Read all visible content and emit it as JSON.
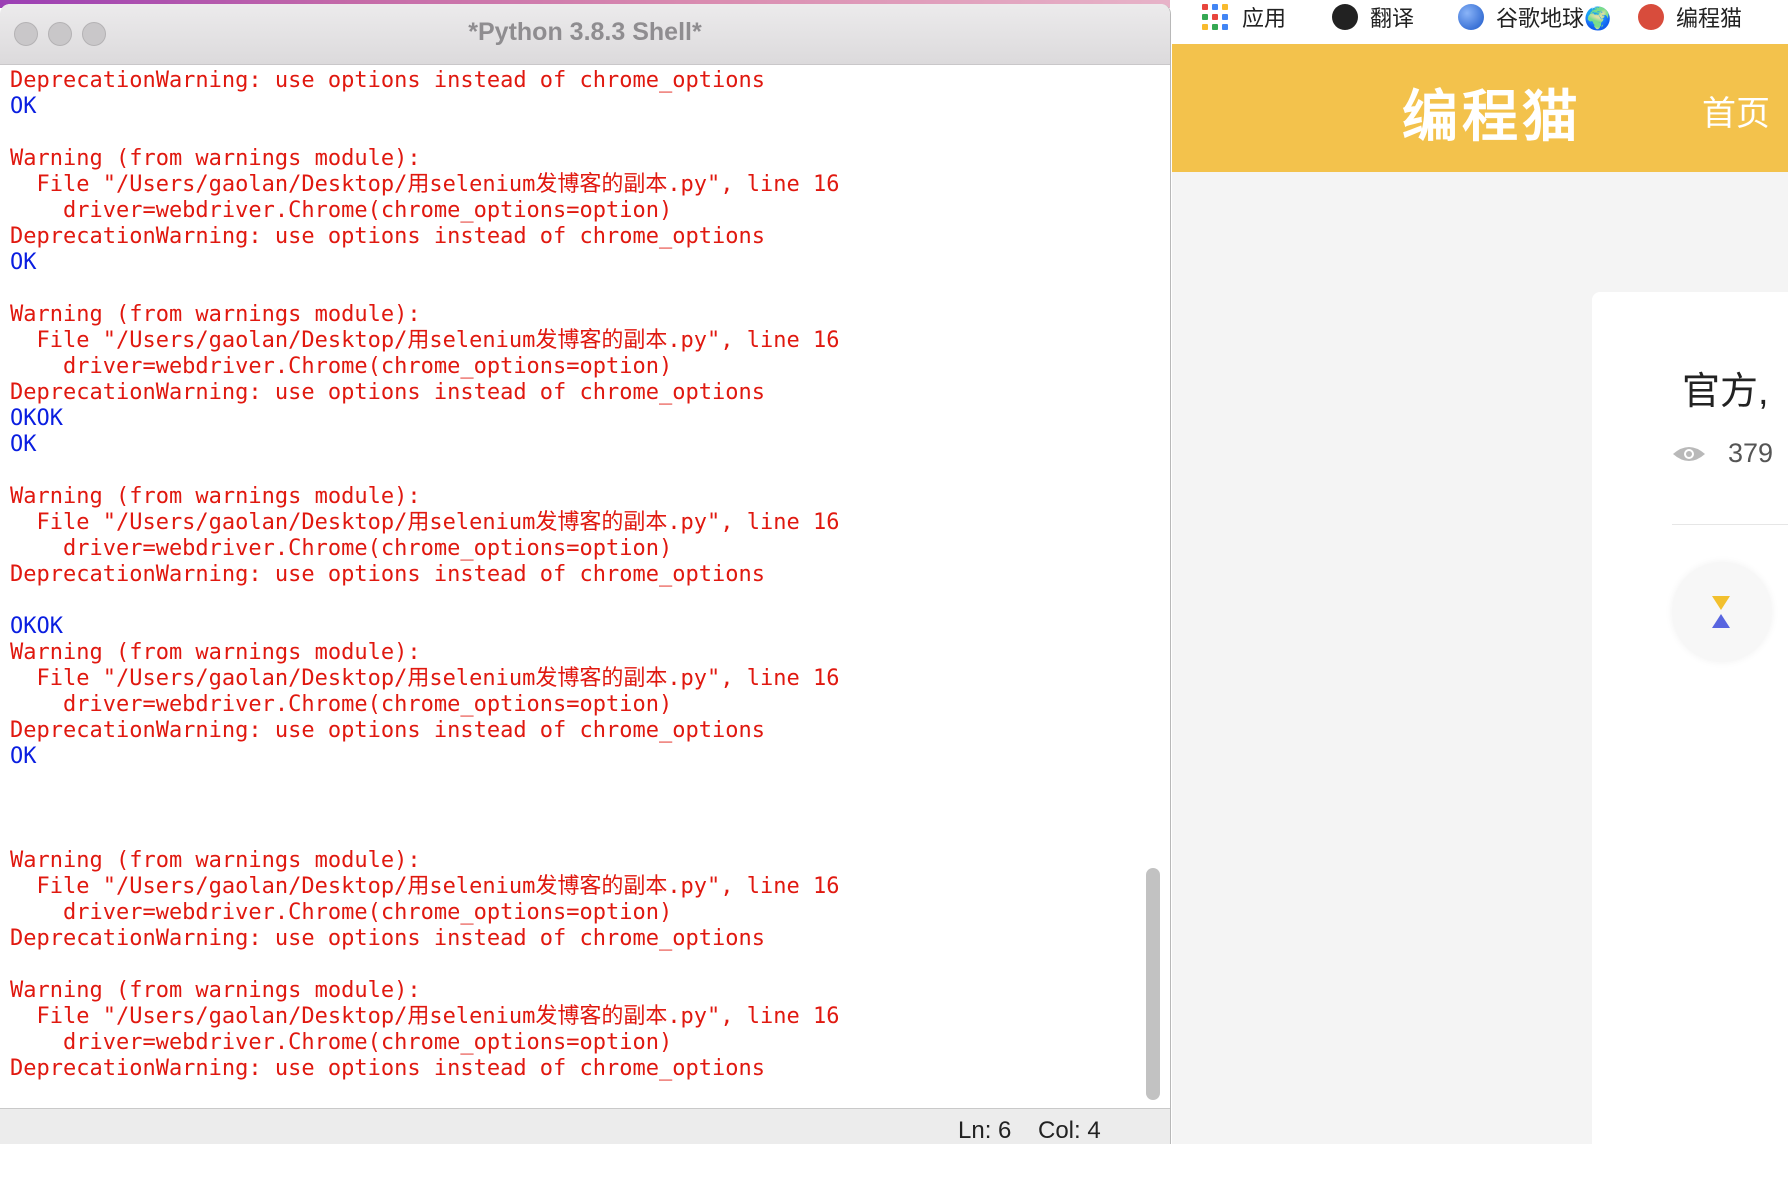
{
  "shell": {
    "title": "*Python 3.8.3 Shell*",
    "lines": [
      {
        "text": "DeprecationWarning: use options instead of chrome_options",
        "kind": "err"
      },
      {
        "text": "OK",
        "kind": "ok"
      },
      {
        "text": "",
        "kind": "err"
      },
      {
        "text": "Warning (from warnings module):",
        "kind": "err"
      },
      {
        "text": "  File \"/Users/gaolan/Desktop/用selenium发博客的副本.py\", line 16",
        "kind": "err"
      },
      {
        "text": "    driver=webdriver.Chrome(chrome_options=option)",
        "kind": "err"
      },
      {
        "text": "DeprecationWarning: use options instead of chrome_options",
        "kind": "err"
      },
      {
        "text": "OK",
        "kind": "ok"
      },
      {
        "text": "",
        "kind": "err"
      },
      {
        "text": "Warning (from warnings module):",
        "kind": "err"
      },
      {
        "text": "  File \"/Users/gaolan/Desktop/用selenium发博客的副本.py\", line 16",
        "kind": "err"
      },
      {
        "text": "    driver=webdriver.Chrome(chrome_options=option)",
        "kind": "err"
      },
      {
        "text": "DeprecationWarning: use options instead of chrome_options",
        "kind": "err"
      },
      {
        "text": "OKOK",
        "kind": "ok"
      },
      {
        "text": "OK",
        "kind": "ok"
      },
      {
        "text": "",
        "kind": "err"
      },
      {
        "text": "Warning (from warnings module):",
        "kind": "err"
      },
      {
        "text": "  File \"/Users/gaolan/Desktop/用selenium发博客的副本.py\", line 16",
        "kind": "err"
      },
      {
        "text": "    driver=webdriver.Chrome(chrome_options=option)",
        "kind": "err"
      },
      {
        "text": "DeprecationWarning: use options instead of chrome_options",
        "kind": "err"
      },
      {
        "text": "",
        "kind": "err"
      },
      {
        "text": "OKOK",
        "kind": "ok"
      },
      {
        "text": "Warning (from warnings module):",
        "kind": "err"
      },
      {
        "text": "  File \"/Users/gaolan/Desktop/用selenium发博客的副本.py\", line 16",
        "kind": "err"
      },
      {
        "text": "    driver=webdriver.Chrome(chrome_options=option)",
        "kind": "err"
      },
      {
        "text": "DeprecationWarning: use options instead of chrome_options",
        "kind": "err"
      },
      {
        "text": "OK",
        "kind": "ok"
      },
      {
        "text": "",
        "kind": "err"
      },
      {
        "text": "",
        "kind": "err"
      },
      {
        "text": "",
        "kind": "err"
      },
      {
        "text": "Warning (from warnings module):",
        "kind": "err"
      },
      {
        "text": "  File \"/Users/gaolan/Desktop/用selenium发博客的副本.py\", line 16",
        "kind": "err"
      },
      {
        "text": "    driver=webdriver.Chrome(chrome_options=option)",
        "kind": "err"
      },
      {
        "text": "DeprecationWarning: use options instead of chrome_options",
        "kind": "err"
      },
      {
        "text": "",
        "kind": "err"
      },
      {
        "text": "Warning (from warnings module):",
        "kind": "err"
      },
      {
        "text": "  File \"/Users/gaolan/Desktop/用selenium发博客的副本.py\", line 16",
        "kind": "err"
      },
      {
        "text": "    driver=webdriver.Chrome(chrome_options=option)",
        "kind": "err"
      },
      {
        "text": "DeprecationWarning: use options instead of chrome_options",
        "kind": "err"
      }
    ],
    "status": {
      "line": "Ln: 6",
      "col": "Col: 4"
    },
    "colors": {
      "error_text": "#e0180f",
      "ok_text": "#0a1ee0"
    }
  },
  "browser": {
    "bookmarks": [
      {
        "label": "应用",
        "icon": "apps-grid-icon"
      },
      {
        "label": "翻译",
        "icon": "translate-icon"
      },
      {
        "label": "谷歌地球🌍",
        "icon": "google-earth-icon"
      },
      {
        "label": "编程猫",
        "icon": "codemao-icon"
      }
    ],
    "site": {
      "logo": "编程猫",
      "nav_home": "首页",
      "card_title": "官方,",
      "views": "379"
    },
    "colors": {
      "banner": "#f3c24c"
    }
  }
}
